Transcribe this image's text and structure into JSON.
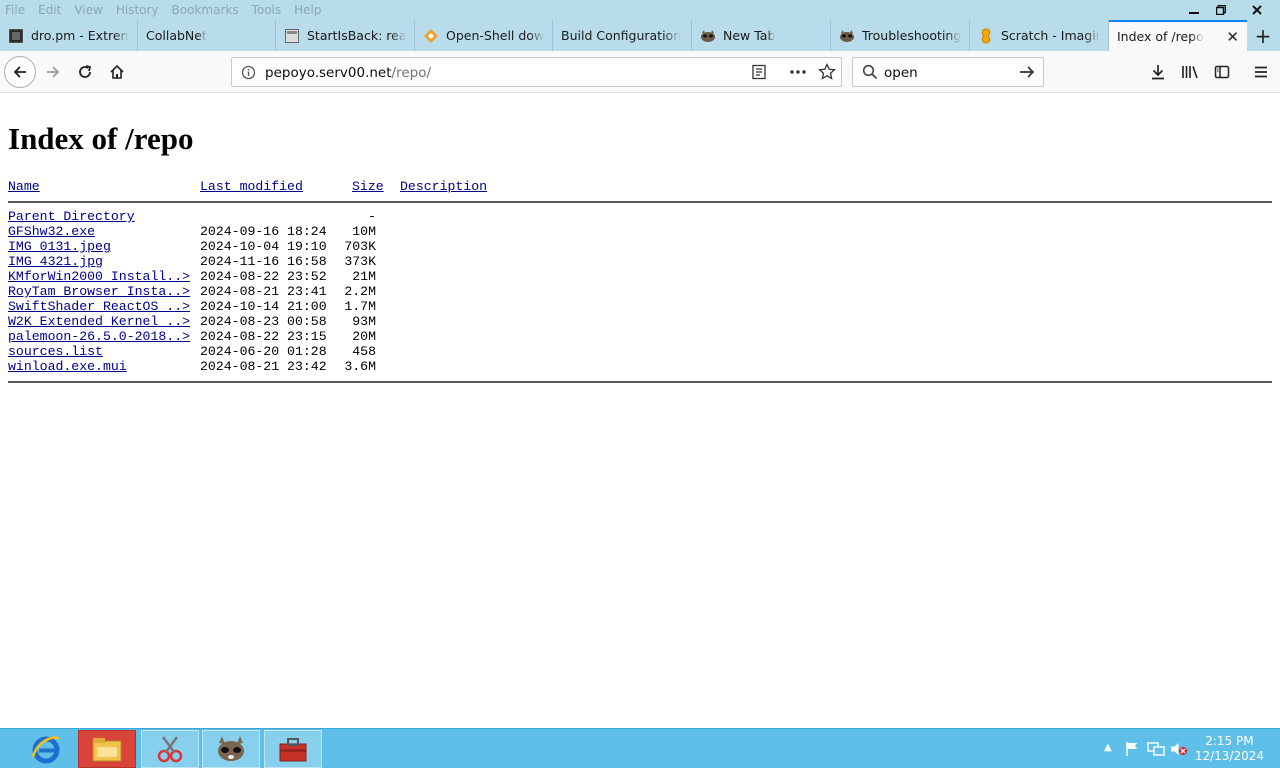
{
  "menu": {
    "items": [
      "File",
      "Edit",
      "View",
      "History",
      "Bookmarks",
      "Tools",
      "Help"
    ]
  },
  "window_controls": {
    "minimize_icon": "minimize-icon",
    "restore_icon": "restore-icon",
    "close_icon": "close-icon"
  },
  "tabs": [
    {
      "label": "dro.pm - Extremel",
      "icon": "page-icon"
    },
    {
      "label": "CollabNet",
      "icon": "none"
    },
    {
      "label": "StartIsBack: real st",
      "icon": "page-icon"
    },
    {
      "label": "Open-Shell downl",
      "icon": "diamond-icon"
    },
    {
      "label": "Build Configuration",
      "icon": "none"
    },
    {
      "label": "New Tab",
      "icon": "raccoon-icon"
    },
    {
      "label": "Troubleshooting",
      "icon": "raccoon-icon"
    },
    {
      "label": "Scratch - Imagine",
      "icon": "scratch-icon"
    },
    {
      "label": "Index of /repo",
      "icon": "none",
      "active": true
    }
  ],
  "navbar": {
    "url_host": "pepoyo.serv00.net",
    "url_path": "/repo/",
    "search_value": "open"
  },
  "page": {
    "title": "Index of /repo",
    "columns": {
      "name": "Name",
      "modified": "Last modified",
      "size": "Size",
      "description": "Description"
    },
    "parent": {
      "name": "Parent Directory",
      "size": "-"
    },
    "rows": [
      {
        "name": "GFShw32.exe",
        "date": "2024-09-16 18:24",
        "size": "10M"
      },
      {
        "name": "IMG 0131.jpeg",
        "date": "2024-10-04 19:10",
        "size": "703K"
      },
      {
        "name": "IMG 4321.jpg",
        "date": "2024-11-16 16:58",
        "size": "373K"
      },
      {
        "name": "KMforWin2000 Install..>",
        "date": "2024-08-22 23:52",
        "size": "21M"
      },
      {
        "name": "RoyTam Browser Insta..>",
        "date": "2024-08-21 23:41",
        "size": "2.2M"
      },
      {
        "name": "SwiftShader ReactOS ..>",
        "date": "2024-10-14 21:00",
        "size": "1.7M"
      },
      {
        "name": "W2K Extended Kernel ..>",
        "date": "2024-08-23 00:58",
        "size": "93M"
      },
      {
        "name": "palemoon-26.5.0-2018..>",
        "date": "2024-08-22 23:15",
        "size": "20M"
      },
      {
        "name": "sources.list",
        "date": "2024-06-20 01:28",
        "size": "458"
      },
      {
        "name": "winload.exe.mui",
        "date": "2024-08-21 23:42",
        "size": "3.6M"
      }
    ]
  },
  "taskbar": {
    "clock_time": "2:15 PM",
    "clock_date": "12/13/2024",
    "items": [
      "ie-icon",
      "file-explorer-icon",
      "snipping-tool-icon",
      "browser-icon",
      "toolbox-icon"
    ]
  },
  "colors": {
    "tab_accent": "#0a84ff",
    "link": "#00008b",
    "taskbar": "#5ec0e8",
    "titlebar": "#b9dcea"
  }
}
